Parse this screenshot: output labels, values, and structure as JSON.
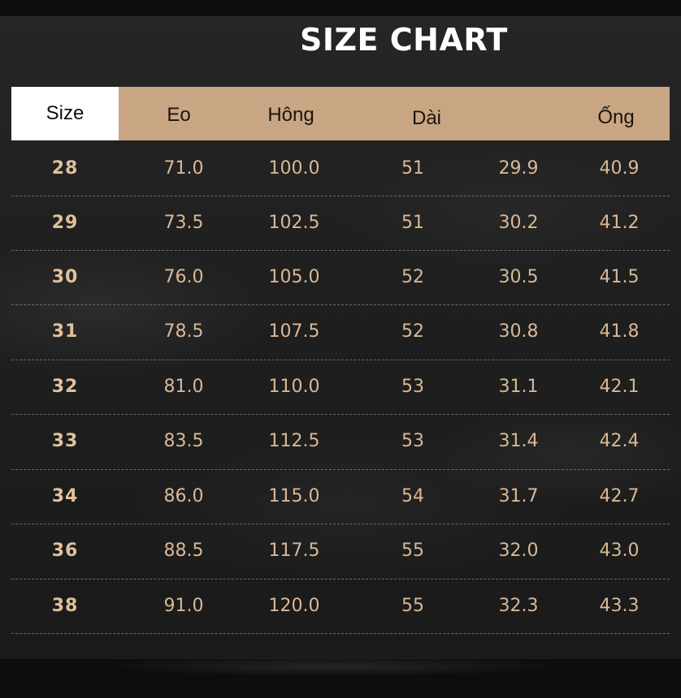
{
  "title": "SIZE CHART",
  "header": {
    "size": "Size",
    "eo": "Eo",
    "hong": "Hông",
    "dai": "Dài",
    "blank": "",
    "ong": "Ống"
  },
  "rows": [
    {
      "size": "28",
      "eo": "71.0",
      "hong": "100.0",
      "dai": "51",
      "c5": "29.9",
      "ong": "40.9"
    },
    {
      "size": "29",
      "eo": "73.5",
      "hong": "102.5",
      "dai": "51",
      "c5": "30.2",
      "ong": "41.2"
    },
    {
      "size": "30",
      "eo": "76.0",
      "hong": "105.0",
      "dai": "52",
      "c5": "30.5",
      "ong": "41.5"
    },
    {
      "size": "31",
      "eo": "78.5",
      "hong": "107.5",
      "dai": "52",
      "c5": "30.8",
      "ong": "41.8"
    },
    {
      "size": "32",
      "eo": "81.0",
      "hong": "110.0",
      "dai": "53",
      "c5": "31.1",
      "ong": "42.1"
    },
    {
      "size": "33",
      "eo": "83.5",
      "hong": "112.5",
      "dai": "53",
      "c5": "31.4",
      "ong": "42.4"
    },
    {
      "size": "34",
      "eo": "86.0",
      "hong": "115.0",
      "dai": "54",
      "c5": "31.7",
      "ong": "42.7"
    },
    {
      "size": "36",
      "eo": "88.5",
      "hong": "117.5",
      "dai": "55",
      "c5": "32.0",
      "ong": "43.0"
    },
    {
      "size": "38",
      "eo": "91.0",
      "hong": "120.0",
      "dai": "55",
      "c5": "32.3",
      "ong": "43.3"
    }
  ],
  "colors": {
    "header_bg": "#c9a683",
    "value_text": "#d9b896",
    "background": "#1f1f1f"
  }
}
